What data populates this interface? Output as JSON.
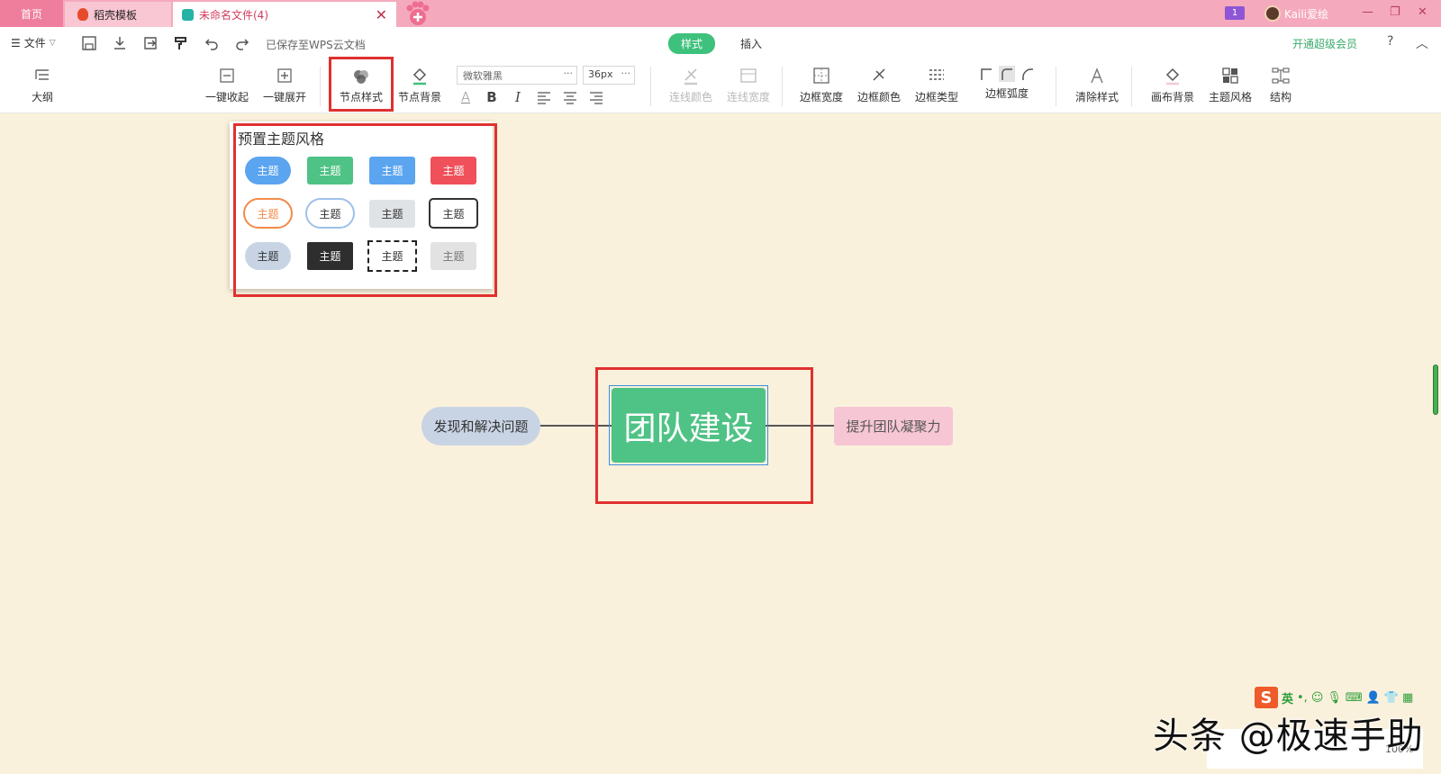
{
  "tabs": {
    "home": "首页",
    "daoke": "稻壳模板",
    "file": "未命名文件(4)"
  },
  "topright": {
    "badge": "1",
    "user": "Kaili爱绘"
  },
  "menu": {
    "file": "文件",
    "saved": "已保存至WPS云文档",
    "mode_style": "样式",
    "mode_insert": "插入",
    "vip": "开通超级会员",
    "help": "?"
  },
  "ribbon": {
    "outline": "大纲",
    "collapse_all": "一键收起",
    "expand_all": "一键展开",
    "node_style": "节点样式",
    "node_bg": "节点背景",
    "font_name": "微软雅黑",
    "font_size": "36px",
    "font_dots": "···",
    "size_dots": "···",
    "line_color": "连线颜色",
    "line_width": "连线宽度",
    "border_width": "边框宽度",
    "border_color": "边框颜色",
    "border_type": "边框类型",
    "border_radius": "边框弧度",
    "clear_style": "清除样式",
    "canvas_bg": "画布背景",
    "theme_style": "主题风格",
    "structure": "结构",
    "fmt_a": "A",
    "fmt_b": "B",
    "fmt_i": "I"
  },
  "popup": {
    "title": "预置主题风格",
    "item_label": "主题",
    "items": [
      "主题",
      "主题",
      "主题",
      "主题",
      "主题",
      "主题",
      "主题",
      "主题",
      "主题",
      "主题",
      "主题",
      "主题"
    ]
  },
  "mindmap": {
    "central": "团队建设",
    "left": "发现和解决问题",
    "right": "提升团队凝聚力"
  },
  "ime": {
    "logo": "S",
    "lang": "英",
    "punct": "•,"
  },
  "zoom": "100%",
  "watermark": "头条 @极速手助",
  "colors": {
    "tab_bar": "#f5a9bd",
    "canvas": "#faf1dc",
    "central_node": "#4fc285",
    "accent_green": "#3ec17d",
    "highlight_red": "#e03030"
  }
}
